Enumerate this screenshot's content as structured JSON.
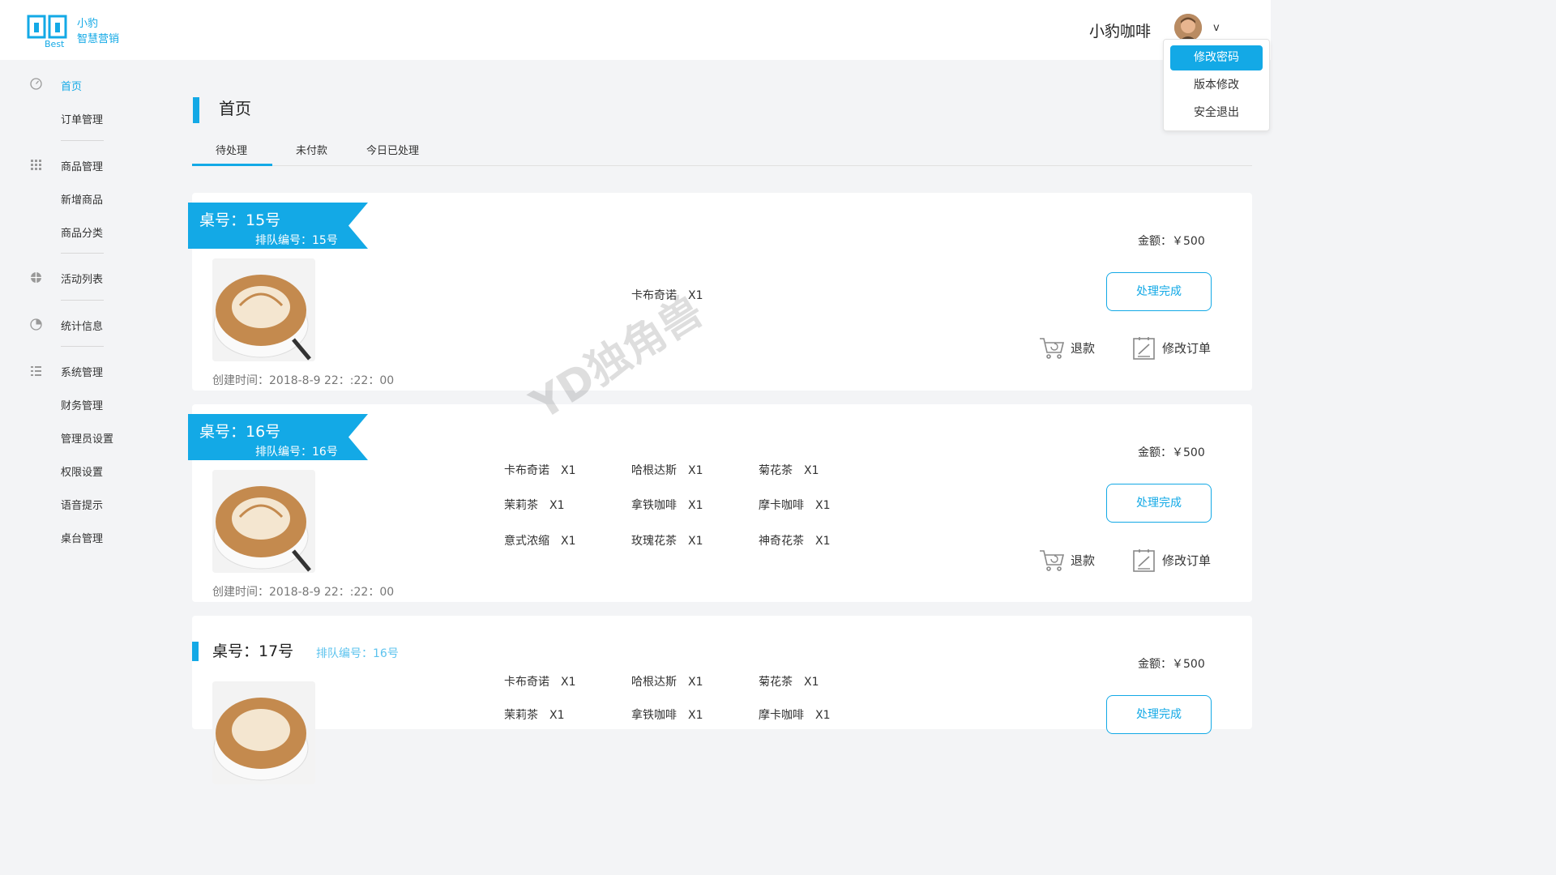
{
  "brand": {
    "line1": "小豹",
    "line2": "智慧营销",
    "logo_word": "Best",
    "accent": "#13a9e6"
  },
  "header": {
    "user_name": "小豹咖啡",
    "caret": "v"
  },
  "dropdown": {
    "items": [
      "修改密码",
      "版本修改",
      "安全退出"
    ],
    "active_index": 0
  },
  "sidebar": {
    "items": [
      "首页",
      "订单管理",
      "商品管理",
      "新增商品",
      "商品分类",
      "活动列表",
      "统计信息",
      "系统管理",
      "财务管理",
      "管理员设置",
      "权限设置",
      "语音提示",
      "桌台管理"
    ],
    "active": "首页"
  },
  "page": {
    "title": "首页",
    "tabs": [
      "待处理",
      "未付款",
      "今日已处理"
    ],
    "active_tab": "待处理"
  },
  "orders": [
    {
      "table": "桌号：15号",
      "queue": "排队编号：15号",
      "amount": "金额：￥500",
      "created": "创建时间：2018-8-9  22：:22：00",
      "items": [
        {
          "name": "卡布奇诺",
          "qty": "X1"
        }
      ],
      "done": "处理完成",
      "refund": "退款",
      "modify": "修改订单"
    },
    {
      "table": "桌号：16号",
      "queue": "排队编号：16号",
      "amount": "金额：￥500",
      "created": "创建时间：2018-8-9  22：:22：00",
      "items": [
        {
          "name": "卡布奇诺",
          "qty": "X1"
        },
        {
          "name": "哈根达斯",
          "qty": "X1"
        },
        {
          "name": "菊花茶",
          "qty": "X1"
        },
        {
          "name": "茉莉茶",
          "qty": "X1"
        },
        {
          "name": "拿铁咖啡",
          "qty": "X1"
        },
        {
          "name": "摩卡咖啡",
          "qty": "X1"
        },
        {
          "name": "意式浓缩",
          "qty": "X1"
        },
        {
          "name": "玫瑰花茶",
          "qty": "X1"
        },
        {
          "name": "神奇花茶",
          "qty": "X1"
        }
      ],
      "done": "处理完成",
      "refund": "退款",
      "modify": "修改订单"
    },
    {
      "table": "桌号：17号",
      "queue": "排队编号：16号",
      "amount": "金额：￥500",
      "items": [
        {
          "name": "卡布奇诺",
          "qty": "X1"
        },
        {
          "name": "哈根达斯",
          "qty": "X1"
        },
        {
          "name": "菊花茶",
          "qty": "X1"
        },
        {
          "name": "茉莉茶",
          "qty": "X1"
        },
        {
          "name": "拿铁咖啡",
          "qty": "X1"
        },
        {
          "name": "摩卡咖啡",
          "qty": "X1"
        }
      ],
      "done": "处理完成"
    }
  ],
  "watermark": "YD独角兽"
}
